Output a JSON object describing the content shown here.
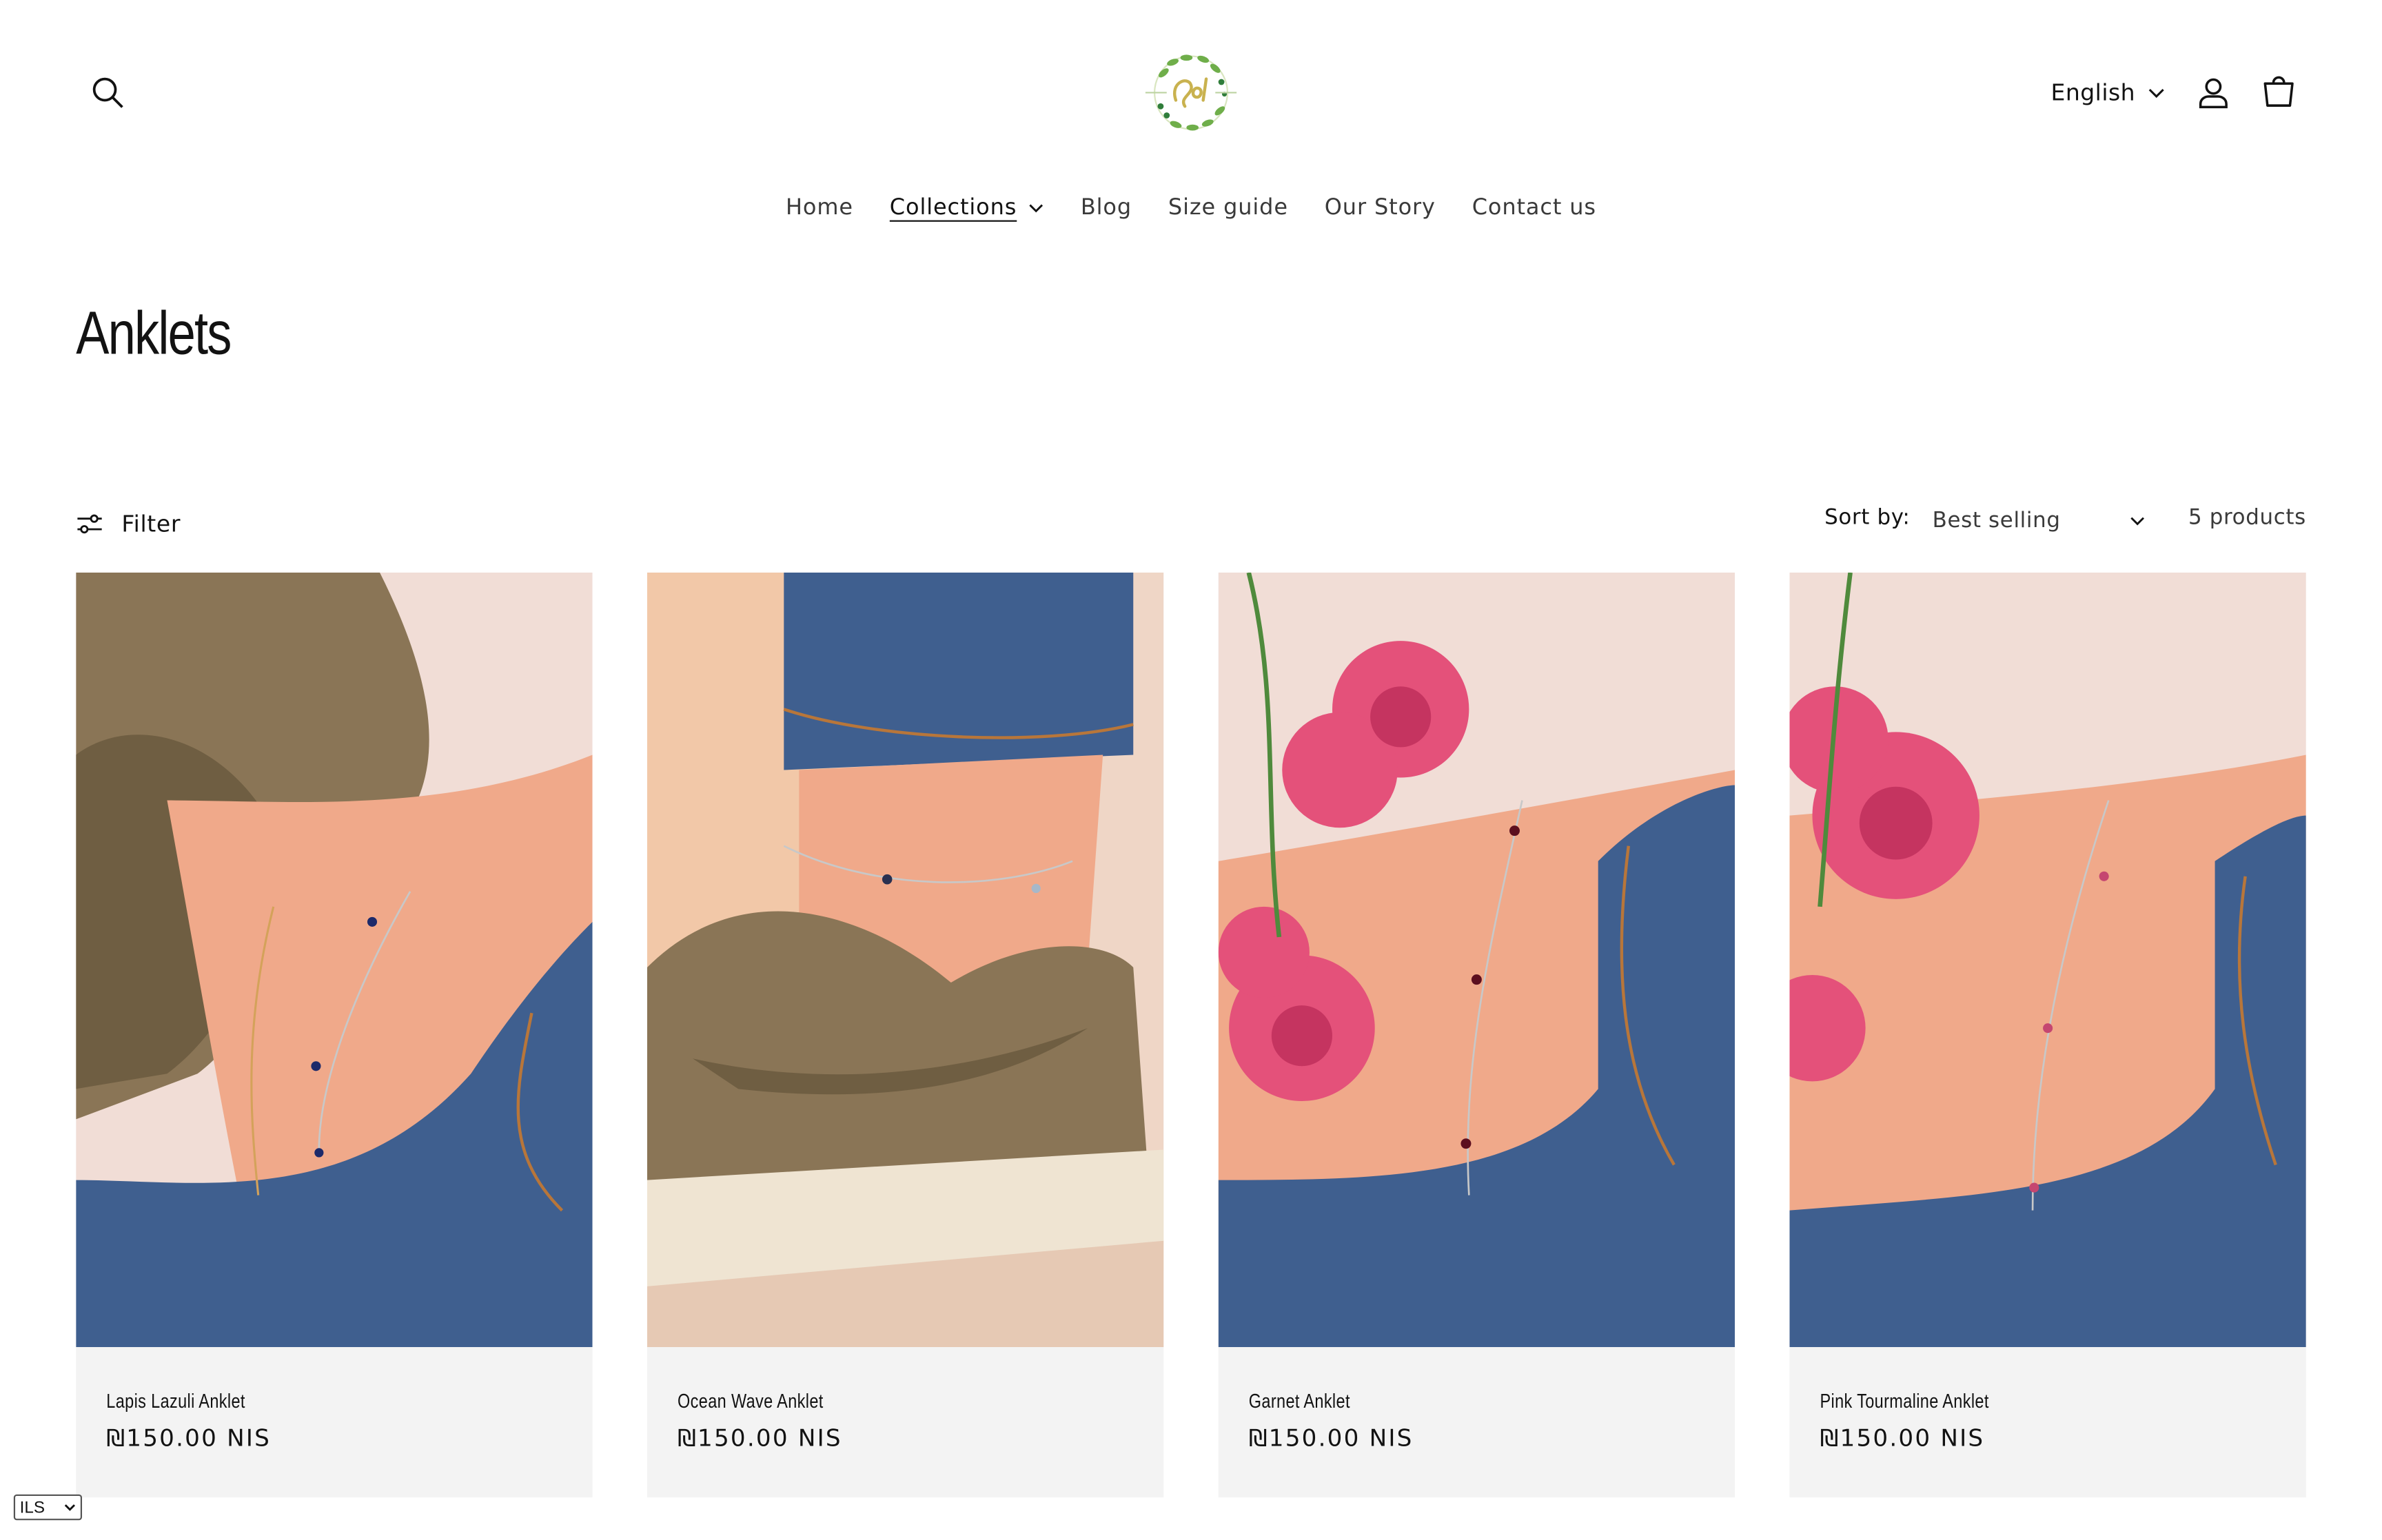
{
  "header": {
    "language": "English",
    "icons": [
      "search-icon",
      "user-icon",
      "cart-icon",
      "chevron-down-icon"
    ]
  },
  "nav": {
    "items": [
      {
        "label": "Home"
      },
      {
        "label": "Collections"
      },
      {
        "label": "Blog"
      },
      {
        "label": "Size guide"
      },
      {
        "label": "Our Story"
      },
      {
        "label": "Contact us"
      }
    ]
  },
  "page": {
    "title": "Anklets"
  },
  "toolbar": {
    "filter_label": "Filter",
    "sort_label": "Sort by:",
    "sort_value": "Best selling",
    "product_count": "5 products"
  },
  "products": [
    {
      "title": "Lapis Lazuli Anklet",
      "price": "₪150.00 NIS"
    },
    {
      "title": "Ocean Wave Anklet",
      "price": "₪150.00 NIS"
    },
    {
      "title": "Garnet Anklet",
      "price": "₪150.00 NIS"
    },
    {
      "title": "Pink Tourmaline Anklet",
      "price": "₪150.00 NIS"
    }
  ],
  "currency_selector": {
    "value": "ILS"
  },
  "colors": {
    "text": "#121212",
    "card_bg": "#f3f3f3",
    "denim": "#3f5f8f",
    "skin": "#f0a98a",
    "background": "#f1ddd6",
    "rose": "#e4517a",
    "suede": "#8a7556"
  }
}
